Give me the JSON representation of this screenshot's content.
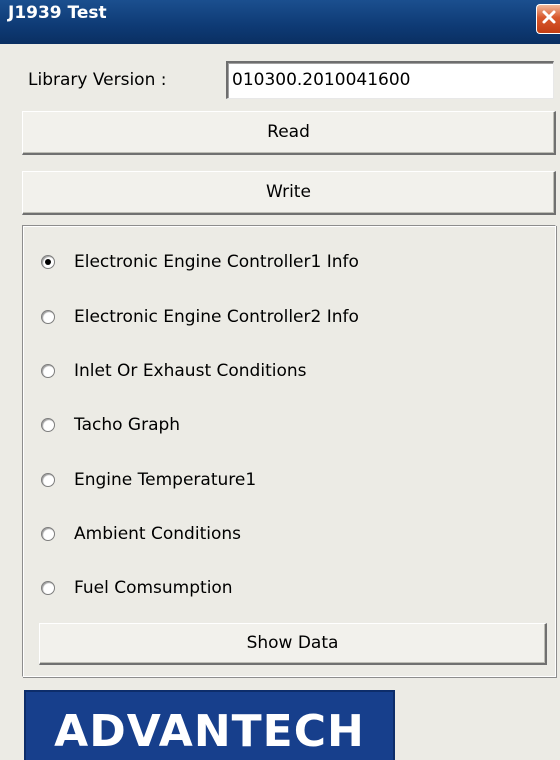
{
  "window": {
    "title": "J1939 Test"
  },
  "library": {
    "label": "Library Version :",
    "value": "010300.2010041600"
  },
  "buttons": {
    "read": "Read",
    "write": "Write",
    "show_data": "Show Data"
  },
  "options": [
    {
      "label": "Electronic Engine Controller1 Info",
      "checked": true
    },
    {
      "label": "Electronic Engine Controller2 Info",
      "checked": false
    },
    {
      "label": "Inlet Or Exhaust Conditions",
      "checked": false
    },
    {
      "label": "Tacho Graph",
      "checked": false
    },
    {
      "label": "Engine Temperature1",
      "checked": false
    },
    {
      "label": "Ambient Conditions",
      "checked": false
    },
    {
      "label": "Fuel Comsumption",
      "checked": false
    }
  ],
  "logo": {
    "text": "ADVANTECH"
  },
  "colors": {
    "titlebar": "#0e3a74",
    "close_button": "#d9582c",
    "logo_background": "#173f8c"
  },
  "icons": {
    "close": "close-icon"
  }
}
